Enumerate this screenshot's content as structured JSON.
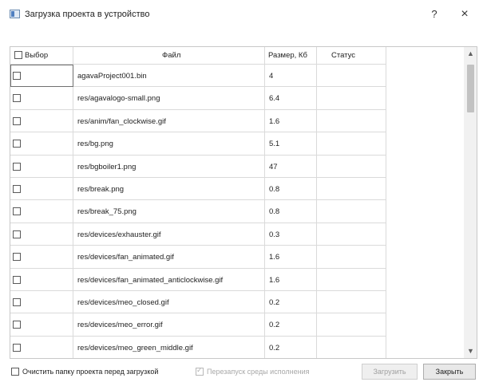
{
  "window": {
    "title": "Загрузка проекта в устройство",
    "help_label": "?",
    "close_label": "×"
  },
  "table": {
    "columns": {
      "select": "Выбор",
      "file": "Файл",
      "size": "Размер, Кб",
      "status": "Статус"
    },
    "rows": [
      {
        "file": "agavaProject001.bin",
        "size": "4",
        "status": "",
        "checked": false
      },
      {
        "file": "res/agavalogo-small.png",
        "size": "6.4",
        "status": "",
        "checked": false
      },
      {
        "file": "res/anim/fan_clockwise.gif",
        "size": "1.6",
        "status": "",
        "checked": false
      },
      {
        "file": "res/bg.png",
        "size": "5.1",
        "status": "",
        "checked": false
      },
      {
        "file": "res/bgboiler1.png",
        "size": "47",
        "status": "",
        "checked": false
      },
      {
        "file": "res/break.png",
        "size": "0.8",
        "status": "",
        "checked": false
      },
      {
        "file": "res/break_75.png",
        "size": "0.8",
        "status": "",
        "checked": false
      },
      {
        "file": "res/devices/exhauster.gif",
        "size": "0.3",
        "status": "",
        "checked": false
      },
      {
        "file": "res/devices/fan_animated.gif",
        "size": "1.6",
        "status": "",
        "checked": false
      },
      {
        "file": "res/devices/fan_animated_anticlockwise.gif",
        "size": "1.6",
        "status": "",
        "checked": false
      },
      {
        "file": "res/devices/meo_closed.gif",
        "size": "0.2",
        "status": "",
        "checked": false
      },
      {
        "file": "res/devices/meo_error.gif",
        "size": "0.2",
        "status": "",
        "checked": false
      },
      {
        "file": "res/devices/meo_green_middle.gif",
        "size": "0.2",
        "status": "",
        "checked": false
      }
    ]
  },
  "footer": {
    "clear_folder_label": "Очистить папку проекта перед загрузкой",
    "clear_folder_checked": false,
    "restart_label": "Перезапуск среды исполнения",
    "restart_checked": true,
    "restart_disabled": true,
    "upload_button": "Загрузить",
    "upload_disabled": true,
    "close_button": "Закрыть"
  }
}
